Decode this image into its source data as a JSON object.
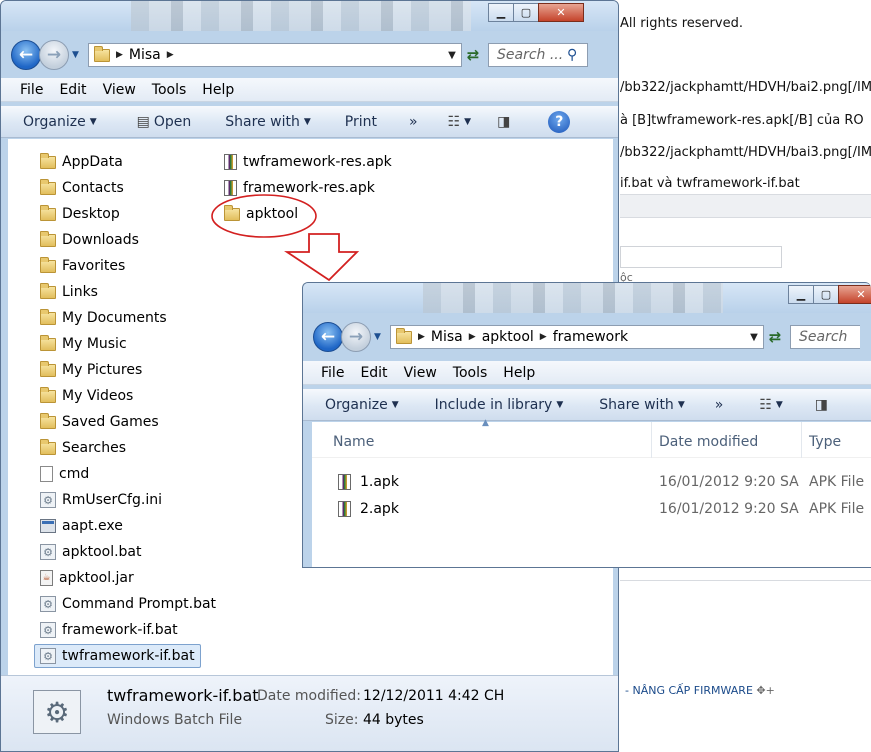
{
  "background_page": {
    "lines": [
      "All rights reserved.",
      "/bb322/jackphamtt/HDVH/bai2.png[/IM",
      "à [B]twframework-res.apk[/B] của RO",
      "/bb322/jackphamtt/HDVH/bai3.png[/IM",
      "if.bat và twframework-if.bat",
      "ộc"
    ],
    "footer_link": "- NÂNG CẤP FIRMWARE"
  },
  "window1": {
    "address": [
      "Misa"
    ],
    "search_placeholder": "Search ...",
    "menu": [
      "File",
      "Edit",
      "View",
      "Tools",
      "Help"
    ],
    "toolbar": {
      "organize": "Organize",
      "open": "Open",
      "share_with": "Share with",
      "print": "Print",
      "more": "»"
    },
    "tree": [
      {
        "label": "AppData",
        "icon": "folder"
      },
      {
        "label": "Contacts",
        "icon": "folder"
      },
      {
        "label": "Desktop",
        "icon": "folder"
      },
      {
        "label": "Downloads",
        "icon": "folder"
      },
      {
        "label": "Favorites",
        "icon": "folder"
      },
      {
        "label": "Links",
        "icon": "folder"
      },
      {
        "label": "My Documents",
        "icon": "folder"
      },
      {
        "label": "My Music",
        "icon": "folder"
      },
      {
        "label": "My Pictures",
        "icon": "folder"
      },
      {
        "label": "My Videos",
        "icon": "folder"
      },
      {
        "label": "Saved Games",
        "icon": "folder"
      },
      {
        "label": "Searches",
        "icon": "folder"
      },
      {
        "label": "cmd",
        "icon": "file"
      },
      {
        "label": "RmUserCfg.ini",
        "icon": "bat"
      },
      {
        "label": "aapt.exe",
        "icon": "exe"
      },
      {
        "label": "apktool.bat",
        "icon": "bat"
      },
      {
        "label": "apktool.jar",
        "icon": "jar"
      },
      {
        "label": "Command Prompt.bat",
        "icon": "bat"
      },
      {
        "label": "framework-if.bat",
        "icon": "bat"
      },
      {
        "label": "twframework-if.bat",
        "icon": "bat",
        "selected": true
      }
    ],
    "column2": [
      {
        "label": "twframework-res.apk",
        "icon": "apk"
      },
      {
        "label": "framework-res.apk",
        "icon": "apk"
      },
      {
        "label": "apktool",
        "icon": "folder"
      }
    ],
    "details": {
      "filename": "twframework-if.bat",
      "type": "Windows Batch File",
      "date_label": "Date modified:",
      "date_value": "12/12/2011 4:42 CH",
      "size_label": "Size:",
      "size_value": "44 bytes"
    }
  },
  "window2": {
    "address": [
      "Misa",
      "apktool",
      "framework"
    ],
    "search_placeholder": "Search",
    "menu": [
      "File",
      "Edit",
      "View",
      "Tools",
      "Help"
    ],
    "toolbar": {
      "organize": "Organize",
      "include_in_library": "Include in library",
      "share_with": "Share with",
      "more": "»"
    },
    "columns": {
      "name": "Name",
      "date_modified": "Date modified",
      "type": "Type"
    },
    "files": [
      {
        "name": "1.apk",
        "date": "16/01/2012 9:20 SA",
        "type": "APK File"
      },
      {
        "name": "2.apk",
        "date": "16/01/2012 9:20 SA",
        "type": "APK File"
      }
    ]
  },
  "colors": {
    "annotation_red": "#d32020",
    "selection": "#dceaf9",
    "chrome": "#bcd3ea"
  }
}
